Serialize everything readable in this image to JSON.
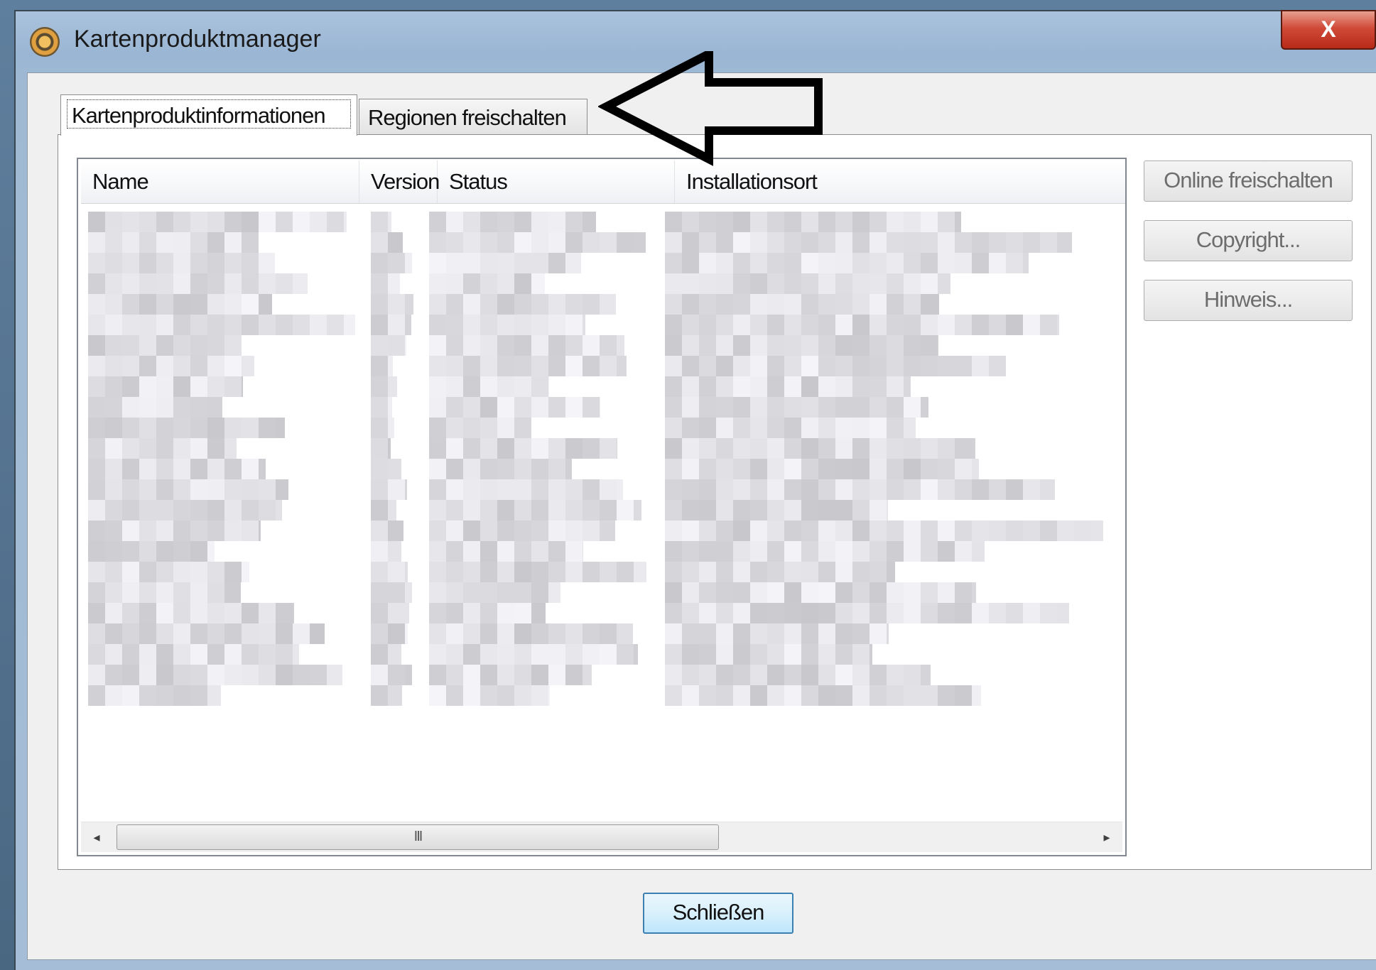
{
  "window": {
    "title": "Kartenproduktmanager",
    "close_glyph": "X"
  },
  "tabs": [
    {
      "label": "Kartenproduktinformationen",
      "active": true
    },
    {
      "label": "Regionen freischalten",
      "active": false
    }
  ],
  "list": {
    "columns": [
      "Name",
      "Version",
      "Status",
      "Installationsort"
    ],
    "row_count": 24,
    "rows_obscured": true,
    "scrollbar": {
      "thumb_grip": "III",
      "left_arrow": "◂",
      "right_arrow": "▸"
    }
  },
  "side_buttons": {
    "online": "Online freischalten",
    "copyright": "Copyright...",
    "hint": "Hinweis..."
  },
  "footer": {
    "close_label": "Schließen"
  },
  "annotation": {
    "type": "arrow",
    "direction": "left",
    "points_to": "Regionen freischalten",
    "color": "#000000"
  },
  "colors": {
    "close_button": "#c9402d",
    "title_bar": "#9ab6d4",
    "dialog_bg": "#f0f0f0",
    "default_button_border": "#3c7fb1"
  }
}
